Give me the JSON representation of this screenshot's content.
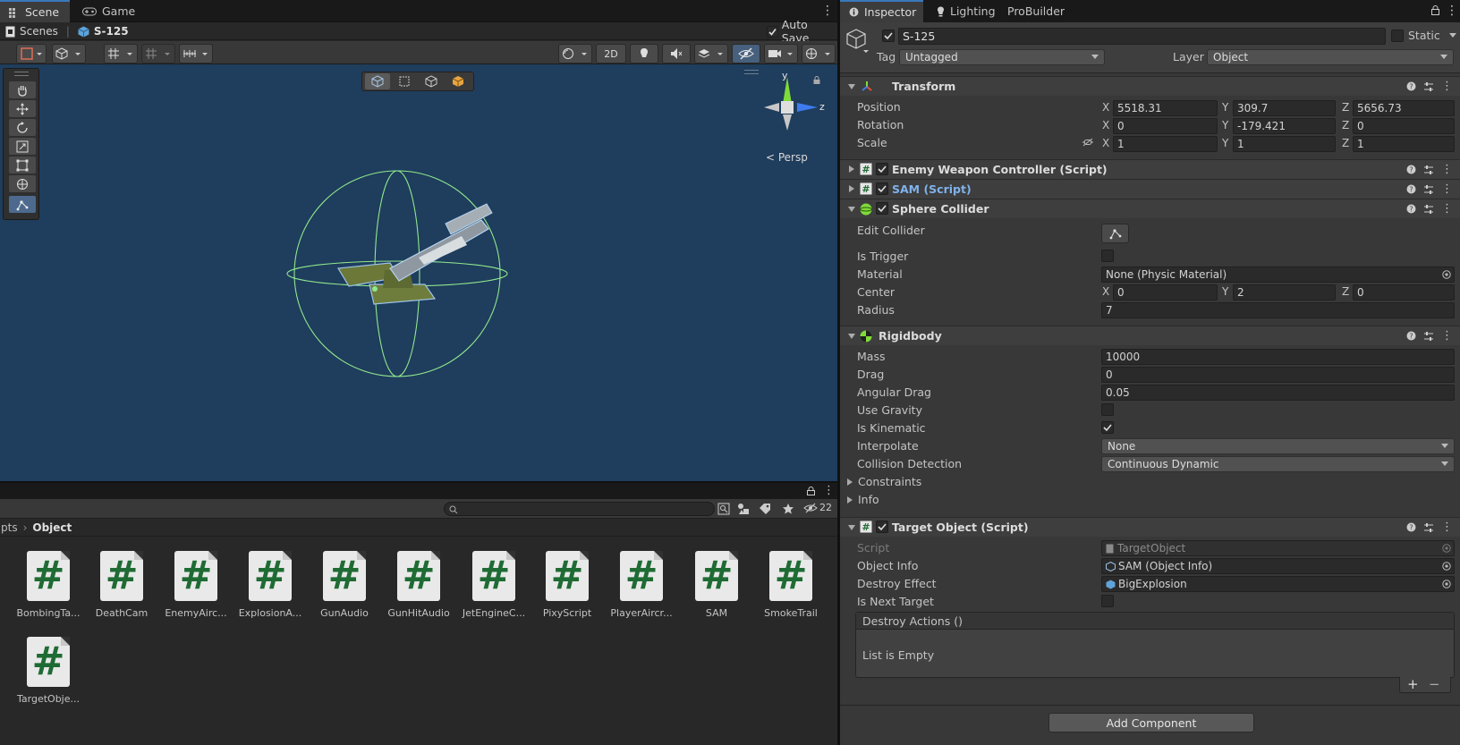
{
  "scene_panel": {
    "tabs": [
      {
        "label": "Scene",
        "icon": "scene-icon"
      },
      {
        "label": "Game",
        "icon": "gamepad-icon"
      }
    ],
    "breadcrumb": {
      "root": "Scenes",
      "current": "S-125"
    },
    "auto_save_label": "Auto Save",
    "auto_save_checked": true,
    "toggle_2d_label": "2D",
    "persp_label": "< Persp",
    "gizmo_axes": {
      "y": "y",
      "z": "z"
    }
  },
  "project_panel": {
    "breadcrumb": {
      "parent": "pts",
      "current": "Object"
    },
    "search_placeholder": "",
    "hidden_count": "22",
    "assets": [
      "BombingTa...",
      "DeathCam",
      "EnemyAirc...",
      "ExplosionA...",
      "GunAudio",
      "GunHitAudio",
      "JetEngineC...",
      "PixyScript",
      "PlayerAircr...",
      "SAM",
      "SmokeTrail",
      "TargetObje..."
    ]
  },
  "inspector": {
    "tabs": [
      {
        "label": "Inspector",
        "icon": "info-icon"
      },
      {
        "label": "Lighting",
        "icon": "bulb-icon"
      },
      {
        "label": "ProBuilder",
        "icon": ""
      }
    ],
    "object_name": "S-125",
    "static_label": "Static",
    "tag_label": "Tag",
    "tag_value": "Untagged",
    "layer_label": "Layer",
    "layer_value": "Object",
    "transform": {
      "title": "Transform",
      "position": {
        "label": "Position",
        "x": "5518.31",
        "y": "309.7",
        "z": "5656.73"
      },
      "rotation": {
        "label": "Rotation",
        "x": "0",
        "y": "-179.421",
        "z": "0"
      },
      "scale": {
        "label": "Scale",
        "x": "1",
        "y": "1",
        "z": "1"
      }
    },
    "enemy_weapon_title": "Enemy Weapon Controller (Script)",
    "sam_title": "SAM (Script)",
    "sphere_collider": {
      "title": "Sphere Collider",
      "edit_collider": "Edit Collider",
      "is_trigger": "Is Trigger",
      "material_label": "Material",
      "material_value": "None (Physic Material)",
      "center_label": "Center",
      "center": {
        "x": "0",
        "y": "2",
        "z": "0"
      },
      "radius_label": "Radius",
      "radius": "7"
    },
    "rigidbody": {
      "title": "Rigidbody",
      "mass_label": "Mass",
      "mass": "10000",
      "drag_label": "Drag",
      "drag": "0",
      "angular_drag_label": "Angular Drag",
      "angular_drag": "0.05",
      "use_gravity": "Use Gravity",
      "is_kinematic": "Is Kinematic",
      "interpolate_label": "Interpolate",
      "interpolate": "None",
      "collision_label": "Collision Detection",
      "collision": "Continuous Dynamic",
      "constraints": "Constraints",
      "info": "Info"
    },
    "target_object": {
      "title": "Target Object (Script)",
      "script_label": "Script",
      "script_value": "TargetObject",
      "object_info_label": "Object Info",
      "object_info_value": "SAM (Object Info)",
      "destroy_effect_label": "Destroy Effect",
      "destroy_effect_value": "BigExplosion",
      "is_next_target": "Is Next Target",
      "destroy_actions": "Destroy Actions ()",
      "list_empty": "List is Empty"
    },
    "add_component": "Add Component",
    "axis_labels": {
      "x": "X",
      "y": "Y",
      "z": "Z"
    }
  }
}
